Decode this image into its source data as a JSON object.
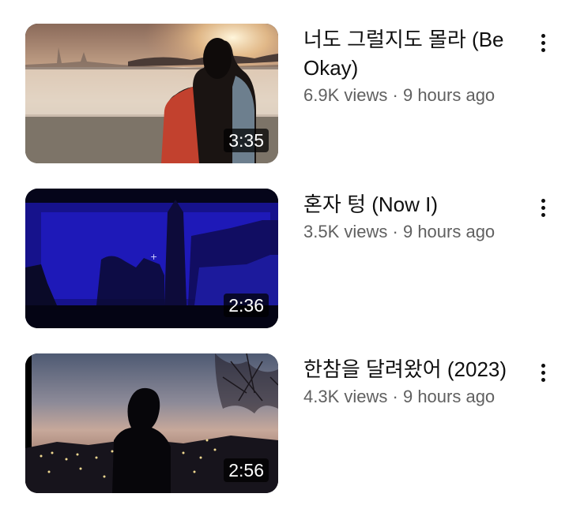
{
  "videos": [
    {
      "title": "너도 그럴지도 몰라 (Be Okay)",
      "views": "6.9K views",
      "separator": "·",
      "age": "9 hours ago",
      "duration": "3:35"
    },
    {
      "title": "혼자 텅 (Now I)",
      "views": "3.5K views",
      "separator": "·",
      "age": "9 hours ago",
      "duration": "2:36"
    },
    {
      "title": "한참을 달려왔어 (2023)",
      "views": "4.3K views",
      "separator": "·",
      "age": "9 hours ago",
      "duration": "2:56"
    }
  ],
  "icons": {
    "more": "more-vert-icon"
  },
  "colors": {
    "title": "#0f0f0f",
    "meta": "#606060",
    "duration_bg": "#000000"
  }
}
